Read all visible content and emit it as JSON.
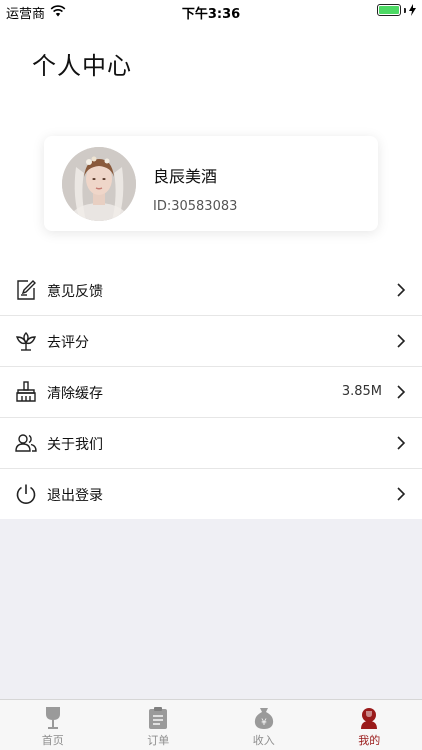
{
  "status_bar": {
    "carrier": "运营商",
    "time": "下午3:36"
  },
  "header": {
    "title": "个人中心"
  },
  "profile": {
    "name": "良辰美酒",
    "id_text": "ID:30583083"
  },
  "menu": {
    "items": [
      {
        "label": "意见反馈",
        "icon": "feedback-edit-icon"
      },
      {
        "label": "去评分",
        "icon": "flower-rate-icon"
      },
      {
        "label": "清除缓存",
        "icon": "broom-icon",
        "value": "3.85M"
      },
      {
        "label": "关于我们",
        "icon": "users-icon"
      },
      {
        "label": "退出登录",
        "icon": "power-icon"
      }
    ]
  },
  "tab_bar": {
    "tabs": [
      {
        "label": "首页",
        "icon": "wine-glass-icon"
      },
      {
        "label": "订单",
        "icon": "clipboard-icon"
      },
      {
        "label": "收入",
        "icon": "money-bag-icon"
      },
      {
        "label": "我的",
        "icon": "profile-wine-icon",
        "active": true
      }
    ]
  },
  "colors": {
    "accent": "#9a1b1b",
    "background": "#efeff4",
    "battery": "#4cd964"
  }
}
